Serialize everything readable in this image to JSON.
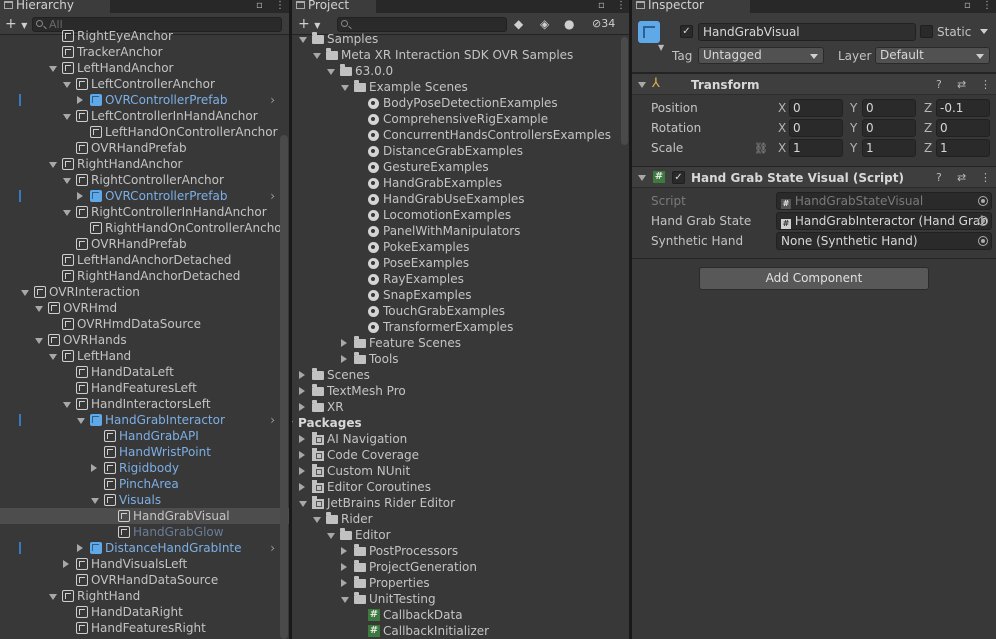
{
  "hierarchy": {
    "tab_label": "Hierarchy",
    "add_label": "+",
    "search_placeholder": "All",
    "rows": [
      {
        "label": "RightEyeAnchor",
        "indent": 4,
        "kind": "go",
        "arrow": "none"
      },
      {
        "label": "TrackerAnchor",
        "indent": 4,
        "kind": "go",
        "arrow": "none"
      },
      {
        "label": "LeftHandAnchor",
        "indent": 4,
        "kind": "go",
        "arrow": "open"
      },
      {
        "label": "LeftControllerAnchor",
        "indent": 5,
        "kind": "go",
        "arrow": "open"
      },
      {
        "label": "OVRControllerPrefab",
        "indent": 6,
        "kind": "prefab",
        "arrow": "closed",
        "chevron": true,
        "marker": true
      },
      {
        "label": "LeftControllerInHandAnchor",
        "indent": 5,
        "kind": "go",
        "arrow": "open"
      },
      {
        "label": "LeftHandOnControllerAnchor",
        "indent": 6,
        "kind": "go",
        "arrow": "none"
      },
      {
        "label": "OVRHandPrefab",
        "indent": 5,
        "kind": "go",
        "arrow": "none"
      },
      {
        "label": "RightHandAnchor",
        "indent": 4,
        "kind": "go",
        "arrow": "open"
      },
      {
        "label": "RightControllerAnchor",
        "indent": 5,
        "kind": "go",
        "arrow": "open"
      },
      {
        "label": "OVRControllerPrefab",
        "indent": 6,
        "kind": "prefab",
        "arrow": "closed",
        "chevron": true,
        "marker": true
      },
      {
        "label": "RightControllerInHandAnchor",
        "indent": 5,
        "kind": "go",
        "arrow": "open"
      },
      {
        "label": "RightHandOnControllerAnchor",
        "indent": 6,
        "kind": "go",
        "arrow": "none"
      },
      {
        "label": "OVRHandPrefab",
        "indent": 5,
        "kind": "go",
        "arrow": "none"
      },
      {
        "label": "LeftHandAnchorDetached",
        "indent": 4,
        "kind": "go",
        "arrow": "none"
      },
      {
        "label": "RightHandAnchorDetached",
        "indent": 4,
        "kind": "go",
        "arrow": "none"
      },
      {
        "label": "OVRInteraction",
        "indent": 2,
        "kind": "go",
        "arrow": "open"
      },
      {
        "label": "OVRHmd",
        "indent": 3,
        "kind": "go",
        "arrow": "open"
      },
      {
        "label": "OVRHmdDataSource",
        "indent": 4,
        "kind": "go",
        "arrow": "none"
      },
      {
        "label": "OVRHands",
        "indent": 3,
        "kind": "go",
        "arrow": "open"
      },
      {
        "label": "LeftHand",
        "indent": 4,
        "kind": "go",
        "arrow": "open"
      },
      {
        "label": "HandDataLeft",
        "indent": 5,
        "kind": "go",
        "arrow": "none"
      },
      {
        "label": "HandFeaturesLeft",
        "indent": 5,
        "kind": "go",
        "arrow": "none"
      },
      {
        "label": "HandInteractorsLeft",
        "indent": 5,
        "kind": "go",
        "arrow": "open"
      },
      {
        "label": "HandGrabInteractor",
        "indent": 6,
        "kind": "prefab",
        "arrow": "open",
        "chevron": true,
        "marker": true
      },
      {
        "label": "HandGrabAPI",
        "indent": 7,
        "kind": "go",
        "arrow": "none",
        "blue": true
      },
      {
        "label": "HandWristPoint",
        "indent": 7,
        "kind": "go",
        "arrow": "none",
        "blue": true
      },
      {
        "label": "Rigidbody",
        "indent": 7,
        "kind": "go",
        "arrow": "closed",
        "blue": true
      },
      {
        "label": "PinchArea",
        "indent": 7,
        "kind": "go",
        "arrow": "none",
        "blue": true
      },
      {
        "label": "Visuals",
        "indent": 7,
        "kind": "go",
        "arrow": "open",
        "blue": true
      },
      {
        "label": "HandGrabVisual",
        "indent": 8,
        "kind": "go",
        "arrow": "none",
        "selected": true
      },
      {
        "label": "HandGrabGlow",
        "indent": 8,
        "kind": "go",
        "arrow": "none",
        "dim": true
      },
      {
        "label": "DistanceHandGrabInte",
        "indent": 6,
        "kind": "prefab",
        "arrow": "closed",
        "chevron": true,
        "marker": true
      },
      {
        "label": "HandVisualsLeft",
        "indent": 5,
        "kind": "go",
        "arrow": "closed"
      },
      {
        "label": "OVRHandDataSource",
        "indent": 5,
        "kind": "go",
        "arrow": "none"
      },
      {
        "label": "RightHand",
        "indent": 4,
        "kind": "go",
        "arrow": "open"
      },
      {
        "label": "HandDataRight",
        "indent": 5,
        "kind": "go",
        "arrow": "none"
      },
      {
        "label": "HandFeaturesRight",
        "indent": 5,
        "kind": "go",
        "arrow": "none"
      }
    ]
  },
  "project": {
    "tab_label": "Project",
    "add_label": "+",
    "search_placeholder": "",
    "hidden_count": "34",
    "rows": [
      {
        "label": "Samples",
        "indent": 1,
        "kind": "folder",
        "arrow": "open"
      },
      {
        "label": "Meta XR Interaction SDK OVR Samples",
        "indent": 2,
        "kind": "folder",
        "arrow": "open"
      },
      {
        "label": "63.0.0",
        "indent": 3,
        "kind": "folder",
        "arrow": "open"
      },
      {
        "label": "Example Scenes",
        "indent": 4,
        "kind": "folder",
        "arrow": "open"
      },
      {
        "label": "BodyPoseDetectionExamples",
        "indent": 5,
        "kind": "scene",
        "arrow": "none"
      },
      {
        "label": "ComprehensiveRigExample",
        "indent": 5,
        "kind": "scene",
        "arrow": "none"
      },
      {
        "label": "ConcurrentHandsControllersExamples",
        "indent": 5,
        "kind": "scene",
        "arrow": "none"
      },
      {
        "label": "DistanceGrabExamples",
        "indent": 5,
        "kind": "scene",
        "arrow": "none"
      },
      {
        "label": "GestureExamples",
        "indent": 5,
        "kind": "scene",
        "arrow": "none"
      },
      {
        "label": "HandGrabExamples",
        "indent": 5,
        "kind": "scene",
        "arrow": "none"
      },
      {
        "label": "HandGrabUseExamples",
        "indent": 5,
        "kind": "scene",
        "arrow": "none"
      },
      {
        "label": "LocomotionExamples",
        "indent": 5,
        "kind": "scene",
        "arrow": "none"
      },
      {
        "label": "PanelWithManipulators",
        "indent": 5,
        "kind": "scene",
        "arrow": "none"
      },
      {
        "label": "PokeExamples",
        "indent": 5,
        "kind": "scene",
        "arrow": "none"
      },
      {
        "label": "PoseExamples",
        "indent": 5,
        "kind": "scene",
        "arrow": "none"
      },
      {
        "label": "RayExamples",
        "indent": 5,
        "kind": "scene",
        "arrow": "none"
      },
      {
        "label": "SnapExamples",
        "indent": 5,
        "kind": "scene",
        "arrow": "none"
      },
      {
        "label": "TouchGrabExamples",
        "indent": 5,
        "kind": "scene",
        "arrow": "none"
      },
      {
        "label": "TransformerExamples",
        "indent": 5,
        "kind": "scene",
        "arrow": "none"
      },
      {
        "label": "Feature Scenes",
        "indent": 4,
        "kind": "folder",
        "arrow": "closed"
      },
      {
        "label": "Tools",
        "indent": 4,
        "kind": "folder",
        "arrow": "closed"
      },
      {
        "label": "Scenes",
        "indent": 1,
        "kind": "folder",
        "arrow": "closed"
      },
      {
        "label": "TextMesh Pro",
        "indent": 1,
        "kind": "folder",
        "arrow": "closed"
      },
      {
        "label": "XR",
        "indent": 1,
        "kind": "folder",
        "arrow": "closed"
      },
      {
        "label": "Packages",
        "indent": 0,
        "kind": "none",
        "arrow": "open",
        "bold": true
      },
      {
        "label": "AI Navigation",
        "indent": 1,
        "kind": "pkg",
        "arrow": "closed"
      },
      {
        "label": "Code Coverage",
        "indent": 1,
        "kind": "pkg",
        "arrow": "closed"
      },
      {
        "label": "Custom NUnit",
        "indent": 1,
        "kind": "pkg",
        "arrow": "closed"
      },
      {
        "label": "Editor Coroutines",
        "indent": 1,
        "kind": "pkg",
        "arrow": "closed"
      },
      {
        "label": "JetBrains Rider Editor",
        "indent": 1,
        "kind": "pkg",
        "arrow": "open"
      },
      {
        "label": "Rider",
        "indent": 2,
        "kind": "folder",
        "arrow": "open"
      },
      {
        "label": "Editor",
        "indent": 3,
        "kind": "folder",
        "arrow": "open"
      },
      {
        "label": "PostProcessors",
        "indent": 4,
        "kind": "folder",
        "arrow": "closed"
      },
      {
        "label": "ProjectGeneration",
        "indent": 4,
        "kind": "folder",
        "arrow": "closed"
      },
      {
        "label": "Properties",
        "indent": 4,
        "kind": "folder",
        "arrow": "closed"
      },
      {
        "label": "UnitTesting",
        "indent": 4,
        "kind": "folder",
        "arrow": "open"
      },
      {
        "label": "CallbackData",
        "indent": 5,
        "kind": "cs",
        "arrow": "none"
      },
      {
        "label": "CallbackInitializer",
        "indent": 5,
        "kind": "cs",
        "arrow": "none"
      }
    ]
  },
  "inspector": {
    "tab_label": "Inspector",
    "object_name": "HandGrabVisual",
    "active_check": "✓",
    "static_label": "Static",
    "tag_label": "Tag",
    "tag_value": "Untagged",
    "layer_label": "Layer",
    "layer_value": "Default",
    "transform": {
      "title": "Transform",
      "position_label": "Position",
      "rotation_label": "Rotation",
      "scale_label": "Scale",
      "x_label": "X",
      "y_label": "Y",
      "z_label": "Z",
      "position": {
        "x": "0",
        "y": "0",
        "z": "-0.1"
      },
      "rotation": {
        "x": "0",
        "y": "0",
        "z": "0"
      },
      "scale": {
        "x": "1",
        "y": "1",
        "z": "1"
      }
    },
    "script_component": {
      "title": "Hand Grab State Visual (Script)",
      "enabled_check": "✓",
      "script_label": "Script",
      "script_value": "HandGrabStateVisual",
      "hand_grab_state_label": "Hand Grab State",
      "hand_grab_state_value": "HandGrabInteractor (Hand Grab",
      "synthetic_hand_label": "Synthetic Hand",
      "synthetic_hand_value": "None (Synthetic Hand)"
    },
    "add_component_label": "Add Component",
    "help_icon": "?",
    "more_icon": "⋮"
  }
}
